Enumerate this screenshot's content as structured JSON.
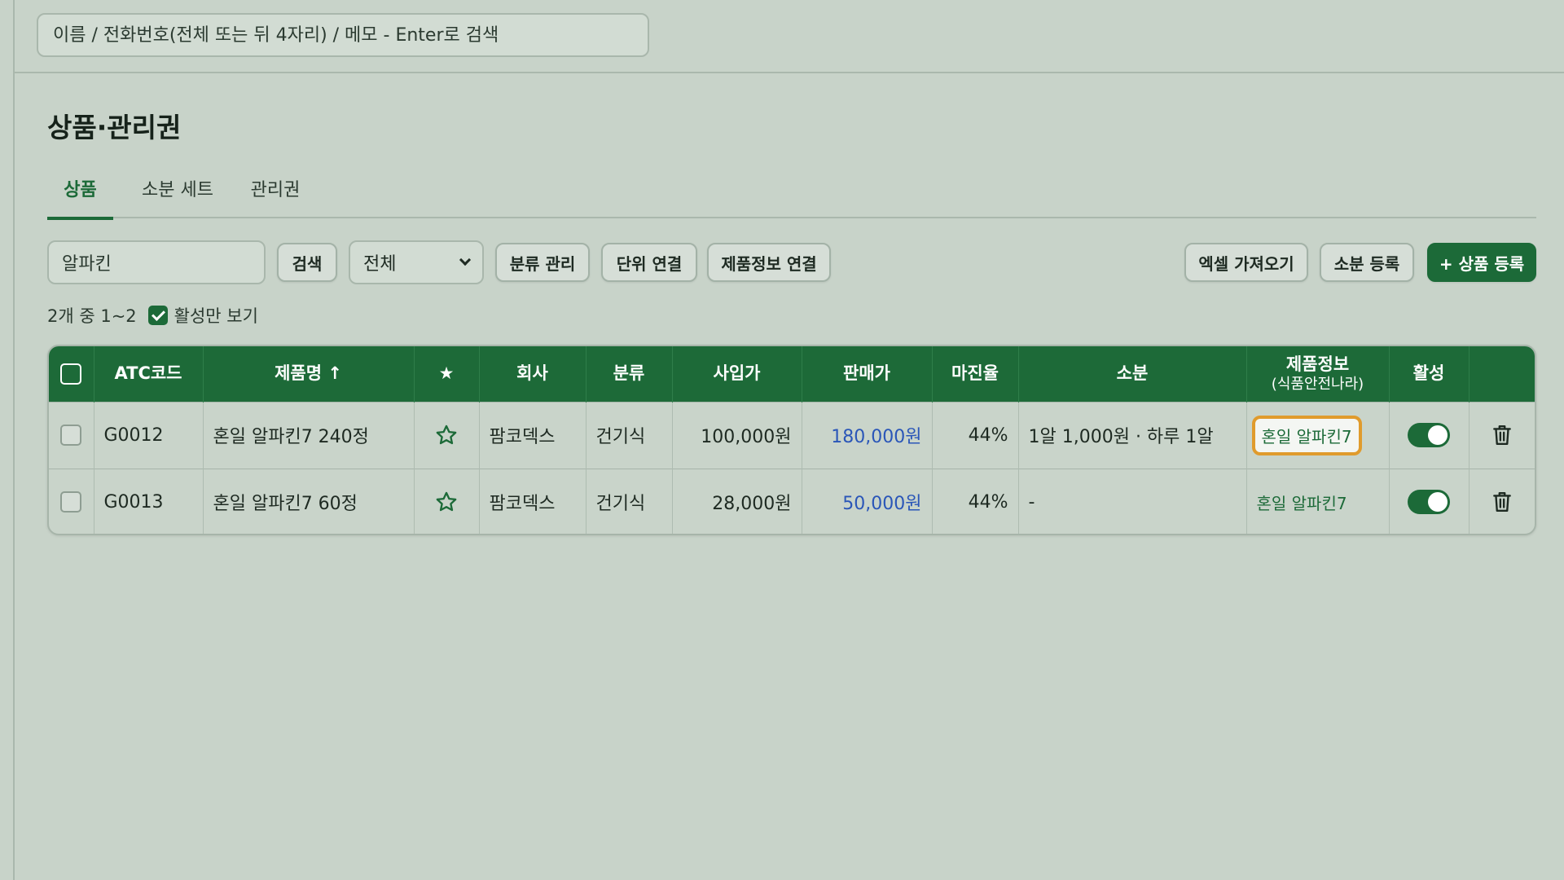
{
  "search": {
    "placeholder": "이름 / 전화번호(전체 또는 뒤 4자리) / 메모 - Enter로 검색"
  },
  "page": {
    "title": "상품·관리권"
  },
  "tabs": [
    {
      "label": "상품",
      "active": true
    },
    {
      "label": "소분 세트",
      "active": false
    },
    {
      "label": "관리권",
      "active": false
    }
  ],
  "toolbar": {
    "filter_value": "알파킨",
    "search_label": "검색",
    "select_value": "전체",
    "category_label": "분류 관리",
    "unit_label": "단위 연결",
    "info_label": "제품정보 연결",
    "excel_label": "엑셀 가져오기",
    "portion_label": "소분 등록",
    "add_label": "+ 상품 등록"
  },
  "summary": {
    "count_text": "2개 중 1~2",
    "active_only_label": "활성만 보기"
  },
  "table": {
    "headers": {
      "code": "ATC코드",
      "name": "제품명 ↑",
      "star": "★",
      "company": "회사",
      "category": "분류",
      "cost": "사입가",
      "price": "판매가",
      "margin": "마진율",
      "portion": "소분",
      "info": "제품정보",
      "info_sub": "(식품안전나라)",
      "active": "활성"
    },
    "rows": [
      {
        "code": "G0012",
        "name": "혼일 알파킨7 240정",
        "company": "팜코덱스",
        "category": "건기식",
        "cost": "100,000원",
        "price": "180,000원",
        "margin": "44%",
        "portion": "1알 1,000원 · 하루 1알",
        "info": "혼일 알파킨7",
        "active": true
      },
      {
        "code": "G0013",
        "name": "혼일 알파킨7 60정",
        "company": "팜코덱스",
        "category": "건기식",
        "cost": "28,000원",
        "price": "50,000원",
        "margin": "44%",
        "portion": "-",
        "info": "혼일 알파킨7",
        "active": true
      }
    ]
  },
  "colors": {
    "accent": "#1c6a38",
    "price_link": "#2a56b8",
    "focus_ring": "#e09b2d",
    "background": "#c8d3c9"
  }
}
